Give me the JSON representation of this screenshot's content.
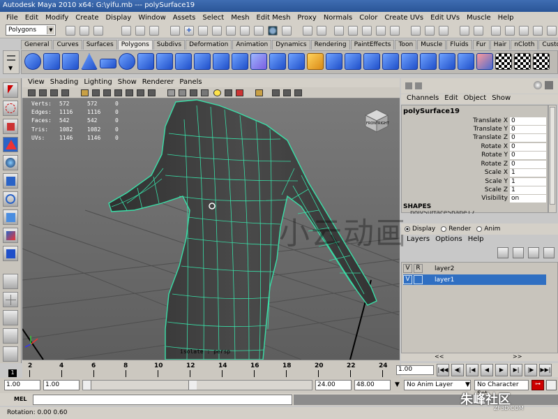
{
  "window": {
    "title": "Autodesk Maya 2010 x64: G:\\yifu.mb   ---   polySurface19"
  },
  "menubar": [
    "File",
    "Edit",
    "Modify",
    "Create",
    "Display",
    "Window",
    "Assets",
    "Select",
    "Mesh",
    "Edit Mesh",
    "Proxy",
    "Normals",
    "Color",
    "Create UVs",
    "Edit UVs",
    "Muscle",
    "Help"
  ],
  "status_line": {
    "mode": "Polygons"
  },
  "shelf": {
    "tabs": [
      "General",
      "Curves",
      "Surfaces",
      "Polygons",
      "Subdivs",
      "Deformation",
      "Animation",
      "Dynamics",
      "Rendering",
      "PaintEffects",
      "Toon",
      "Muscle",
      "Fluids",
      "Fur",
      "Hair",
      "nCloth",
      "Custom"
    ],
    "active_tab": "Polygons"
  },
  "viewport": {
    "menu": [
      "View",
      "Shading",
      "Lighting",
      "Show",
      "Renderer",
      "Panels"
    ],
    "stats": [
      {
        "label": "Verts:",
        "a": "572",
        "b": "572",
        "c": "0"
      },
      {
        "label": "Edges:",
        "a": "1116",
        "b": "1116",
        "c": "0"
      },
      {
        "label": "Faces:",
        "a": "542",
        "b": "542",
        "c": "0"
      },
      {
        "label": "Tris:",
        "a": "1082",
        "b": "1082",
        "c": "0"
      },
      {
        "label": "UVs:",
        "a": "1146",
        "b": "1146",
        "c": "0"
      }
    ],
    "camera_label": "isolate : persp",
    "viewcube": {
      "front": "FRONT",
      "right": "RIGHT"
    },
    "watermark": "小云动画"
  },
  "channel_box": {
    "menu": [
      "Channels",
      "Edit",
      "Object",
      "Show"
    ],
    "object_name": "polySurface19",
    "attributes": [
      {
        "name": "Translate X",
        "value": "0"
      },
      {
        "name": "Translate Y",
        "value": "0"
      },
      {
        "name": "Translate Z",
        "value": "0"
      },
      {
        "name": "Rotate X",
        "value": "0"
      },
      {
        "name": "Rotate Y",
        "value": "0"
      },
      {
        "name": "Rotate Z",
        "value": "0"
      },
      {
        "name": "Scale X",
        "value": "1"
      },
      {
        "name": "Scale Y",
        "value": "1"
      },
      {
        "name": "Scale Z",
        "value": "1"
      },
      {
        "name": "Visibility",
        "value": "on"
      }
    ],
    "shapes_header": "SHAPES",
    "shape_name": "polySurfaceShape17"
  },
  "layer_editor": {
    "radio": [
      "Display",
      "Render",
      "Anim"
    ],
    "active_radio": "Display",
    "menu": [
      "Layers",
      "Options",
      "Help"
    ],
    "layers": [
      {
        "v": "V",
        "p": "R",
        "name": "layer2",
        "selected": false
      },
      {
        "v": "V",
        "p": "",
        "name": "layer1",
        "selected": true
      }
    ]
  },
  "timeline": {
    "ticks": [
      "2",
      "4",
      "6",
      "8",
      "10",
      "12",
      "14",
      "16",
      "18",
      "20",
      "22",
      "24"
    ],
    "current_frame": "1",
    "current_field": "1.00"
  },
  "range": {
    "start": "1.00",
    "playback_start": "1.00",
    "playback_end": "24.00",
    "end": "48.00",
    "anim_layer": "No Anim Layer",
    "character_set": "No Character Set"
  },
  "command_line": {
    "label": "MEL"
  },
  "help_line": {
    "text": "Rotation:  0.00      0.60"
  },
  "corner_watermark": {
    "main": "朱峰社区",
    "sub": "ZF3D.COM"
  }
}
